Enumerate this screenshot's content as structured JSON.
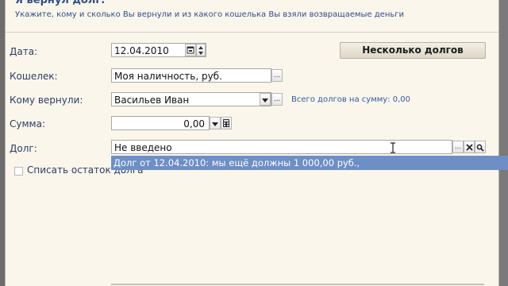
{
  "dialog": {
    "title": "Я вернул долг:",
    "subtitle": "Укажите, кому и сколько Вы вернули и из какого кошелька Вы взяли возвращаемые деньги"
  },
  "form": {
    "date": {
      "label": "Дата:",
      "value": "12.04.2010"
    },
    "wallet": {
      "label": "Кошелек:",
      "value": "Моя наличность, руб."
    },
    "returned_to": {
      "label": "Кому вернули:",
      "value": "Васильев Иван",
      "info": "Всего долгов на сумму: 0,00"
    },
    "amount": {
      "label": "Сумма:",
      "value": "0,00"
    },
    "debt": {
      "label": "Долг:",
      "value": "Не введено"
    },
    "write_off": {
      "label": "Списать остаток долга",
      "checked": false
    }
  },
  "buttons": {
    "several_debts": "Несколько долгов",
    "ellipsis": "..."
  },
  "dropdown": {
    "items": [
      "Долг от 12.04.2010: мы ещё должны 1 000,00 руб.,"
    ]
  },
  "icons": {
    "calendar": "calendar-icon",
    "spin": "spin-arrows-icon",
    "dropdown": "chevron-down-icon",
    "calculator": "calculator-icon",
    "clear": "close-icon",
    "search": "search-icon"
  }
}
